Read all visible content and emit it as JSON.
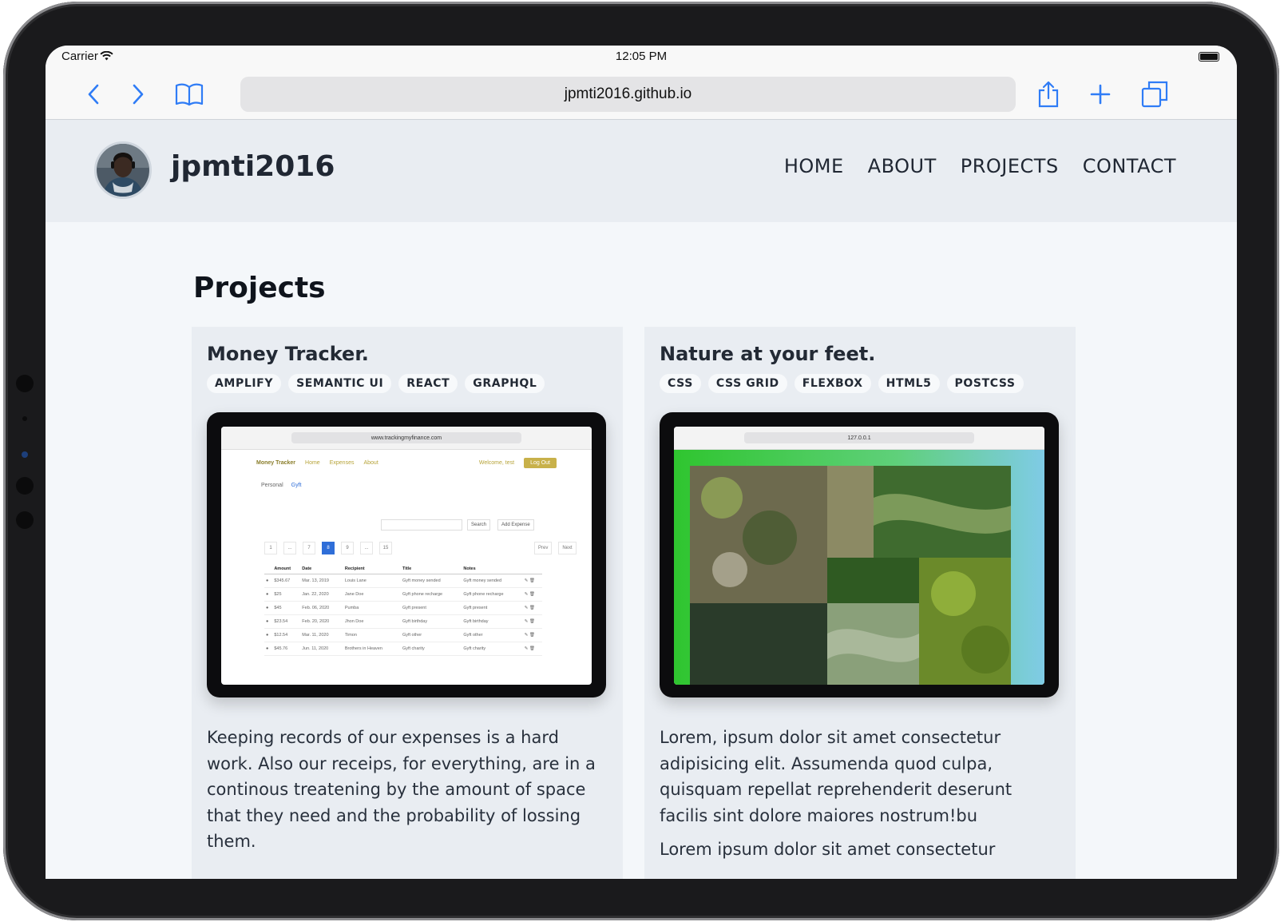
{
  "status_bar": {
    "carrier": "Carrier",
    "time": "12:05 PM"
  },
  "browser": {
    "url": "jpmti2016.github.io"
  },
  "site": {
    "brand": "jpmti2016",
    "nav": [
      "HOME",
      "ABOUT",
      "PROJECTS",
      "CONTACT"
    ]
  },
  "main": {
    "title": "Projects",
    "projects": [
      {
        "title": "Money Tracker.",
        "tags": [
          "AMPLIFY",
          "SEMANTIC UI",
          "REACT",
          "GRAPHQL"
        ],
        "screenshot": {
          "url": "www.trackingmyfinance.com",
          "app_name": "Money Tracker",
          "nav": [
            "Home",
            "Expenses",
            "About"
          ],
          "welcome": "Welcome, test",
          "logout": "Log Out",
          "tabs": [
            "Personal",
            "Gyft"
          ],
          "search_button": "Search",
          "add_button": "Add Expense",
          "pages": [
            "1",
            "...",
            "7",
            "8",
            "9",
            "...",
            "15"
          ],
          "prev": "Prev",
          "next": "Next",
          "columns": [
            "Amount",
            "Date",
            "Recipient",
            "Title",
            "Notes"
          ],
          "rows": [
            [
              "$345.67",
              "Mar. 13, 2019",
              "Louis Lane",
              "Gyft money sended",
              "Gyft money sended"
            ],
            [
              "$25",
              "Jan. 22, 2020",
              "Jane Doe",
              "Gyft phone recharge",
              "Gyft phone recharge"
            ],
            [
              "$45",
              "Feb. 06, 2020",
              "Pumba",
              "Gyft present",
              "Gyft present"
            ],
            [
              "$23.54",
              "Feb. 20, 2020",
              "Jhon Doe",
              "Gyft birthday",
              "Gyft birthday"
            ],
            [
              "$12.54",
              "Mar. 11, 2020",
              "Timon",
              "Gyft other",
              "Gyft other"
            ],
            [
              "$45.76",
              "Jun. 11, 2020",
              "Brothers in Heaven",
              "Gyft charity",
              "Gyft charity"
            ]
          ]
        },
        "description": [
          "Keeping records of our expenses is a hard work. Also our receips, for everything, are in a continous treatening by the amount of space that they need and the probability of lossing them."
        ]
      },
      {
        "title": "Nature at your feet.",
        "tags": [
          "CSS",
          "CSS GRID",
          "FLEXBOX",
          "HTML5",
          "POSTCSS"
        ],
        "screenshot": {
          "url": "127.0.0.1"
        },
        "description": [
          "Lorem, ipsum dolor sit amet consectetur adipisicing elit. Assumenda quod culpa, quisquam repellat reprehenderit deserunt facilis sint dolore maiores nostrum!bu",
          "Lorem ipsum dolor sit amet consectetur"
        ]
      }
    ]
  }
}
